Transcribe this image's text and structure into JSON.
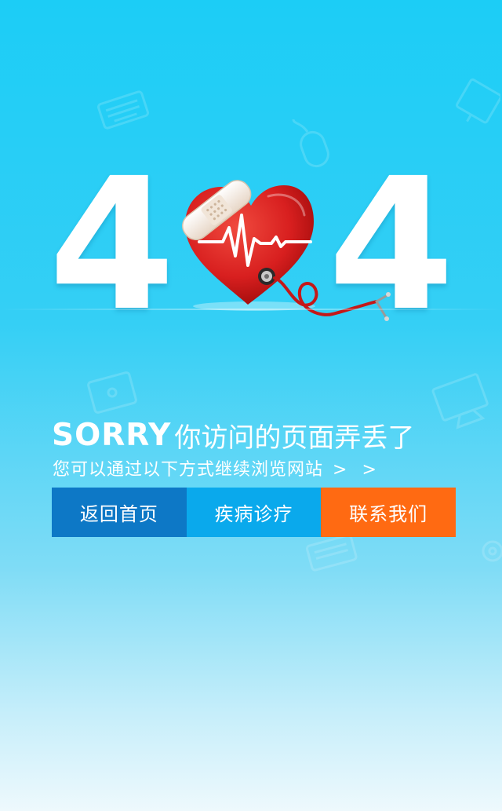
{
  "error": {
    "digit_left": "4",
    "digit_right": "4"
  },
  "headline": {
    "sorry": "SORRY",
    "message": "你访问的页面弄丢了"
  },
  "subline": {
    "text": "您可以通过以下方式继续浏览网站",
    "arrows": "> >"
  },
  "nav": {
    "home_label": "返回首页",
    "disease_label": "疾病诊疗",
    "contact_label": "联系我们"
  },
  "icons": {
    "main_art": "heart-with-bandage-stethoscope-icon",
    "decorations": [
      "keyboard-icon",
      "mouse-icon",
      "monitor-icon",
      "tablet-icon",
      "desktop-icon",
      "gear-icon"
    ]
  },
  "colors": {
    "background_top": "#1ccdf6",
    "background_bottom": "#eef9fd",
    "home_button": "#0d78c6",
    "disease_button": "#0aa9ec",
    "contact_button": "#ff6a12",
    "heart_red": "#d81f1f"
  }
}
